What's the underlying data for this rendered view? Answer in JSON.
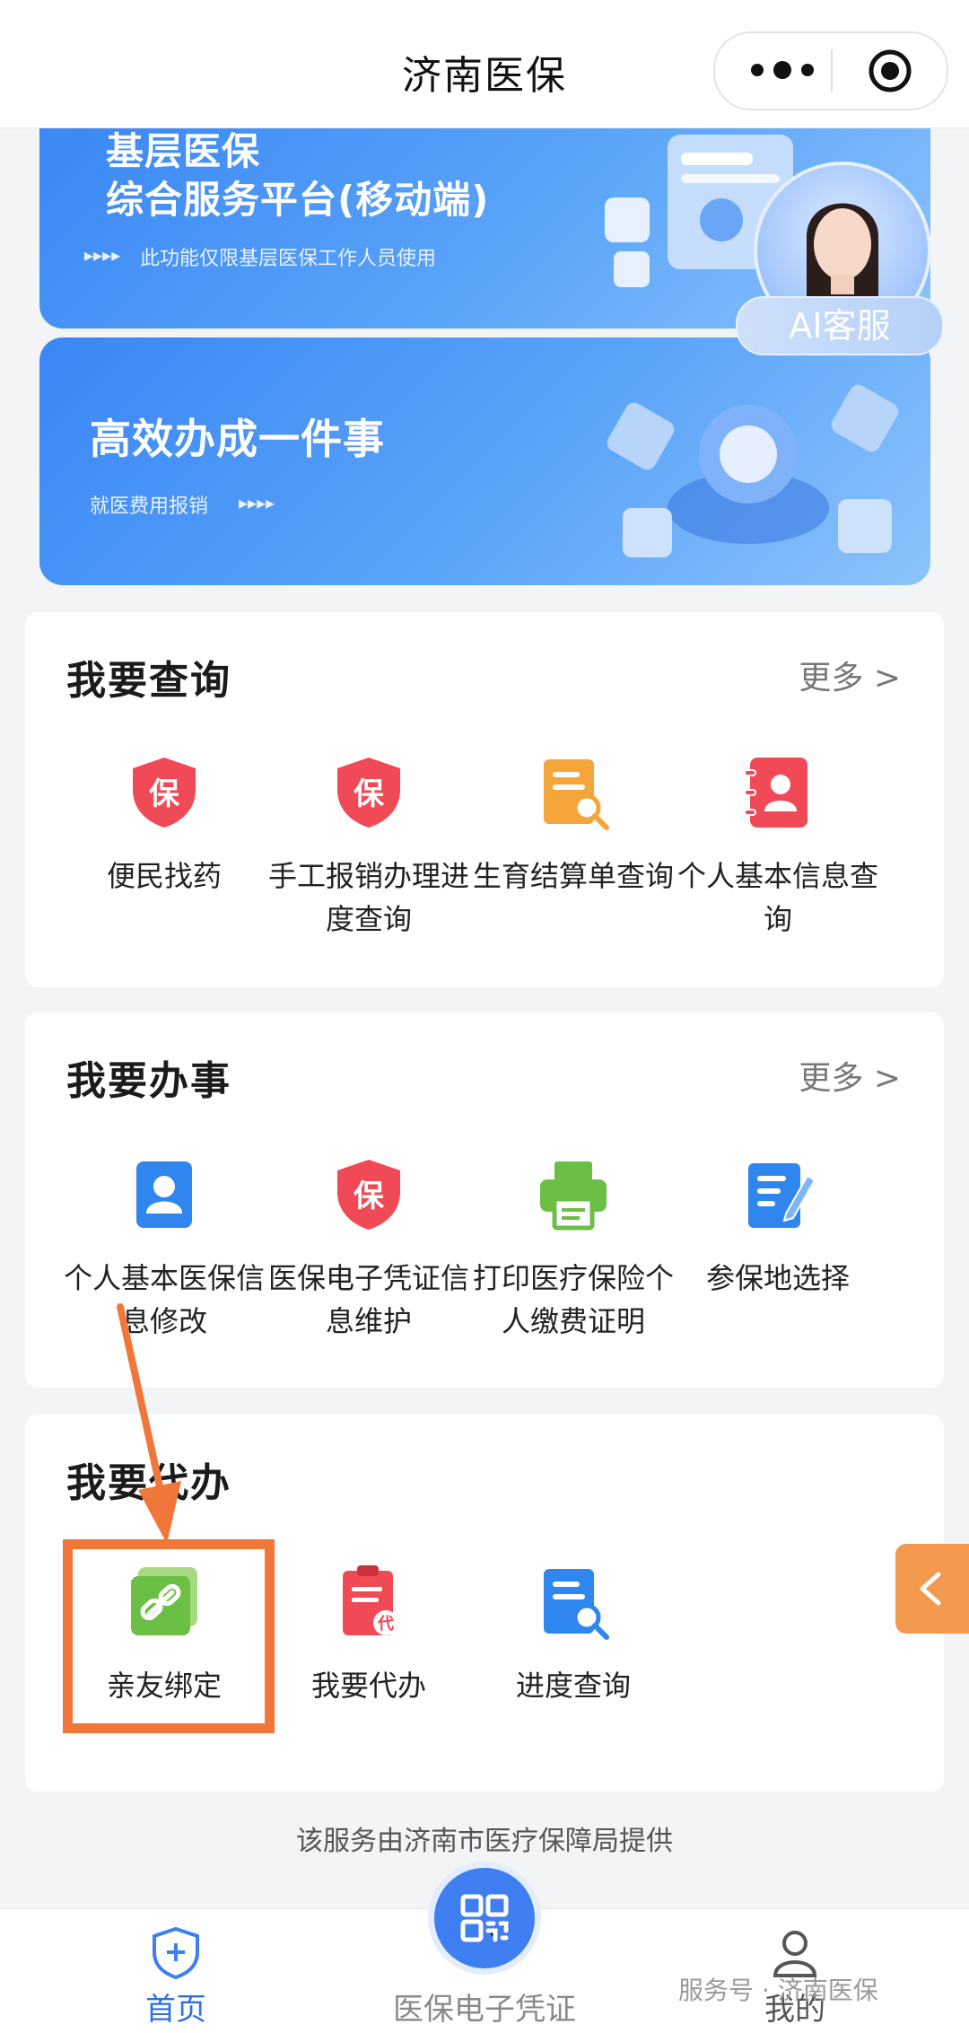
{
  "titlebar": {
    "title": "济南医保",
    "more_icon": "more-dots-icon",
    "close_icon": "target-circle-icon"
  },
  "banners": [
    {
      "title_line1": "基层医保",
      "title_line2": "综合服务平台(移动端)",
      "subtitle": "此功能仅限基层医保工作人员使用"
    },
    {
      "title": "高效办成一件事",
      "subtitle": "就医费用报销"
    }
  ],
  "ai_service": {
    "label": "AI客服"
  },
  "sections": {
    "query": {
      "title": "我要查询",
      "more": "更多 >",
      "items": [
        {
          "label": "便民找药",
          "icon": "shield-bao-icon",
          "color": "#ef4a55"
        },
        {
          "label": "手工报销办理进度查询",
          "icon": "shield-bao-icon",
          "color": "#ef4a55"
        },
        {
          "label": "生育结算单查询",
          "icon": "document-search-icon",
          "color": "#f6a53b"
        },
        {
          "label": "个人基本信息查询",
          "icon": "contact-book-icon",
          "color": "#ef4a55"
        }
      ]
    },
    "handle": {
      "title": "我要办事",
      "more": "更多 >",
      "items": [
        {
          "label": "个人基本医保信息修改",
          "icon": "person-card-icon",
          "color": "#2f86ee"
        },
        {
          "label": "医保电子凭证信息维护",
          "icon": "shield-bao-icon",
          "color": "#ef4a55"
        },
        {
          "label": "打印医疗保险个人缴费证明",
          "icon": "printer-icon",
          "color": "#6cbf45"
        },
        {
          "label": "参保地选择",
          "icon": "edit-document-icon",
          "color": "#2f86ee"
        }
      ]
    },
    "proxy": {
      "title": "我要代办",
      "items": [
        {
          "label": "亲友绑定",
          "icon": "link-icon",
          "color": "#6cbf45"
        },
        {
          "label": "我要代办",
          "icon": "proxy-document-icon",
          "color": "#ef4a55"
        },
        {
          "label": "进度查询",
          "icon": "document-search-icon",
          "color": "#2f86ee"
        }
      ]
    }
  },
  "provider_text": "该服务由济南市医疗保障局提供",
  "tabbar": {
    "home": "首页",
    "voucher": "医保电子凭证",
    "mine": "我的"
  },
  "watermark": "服务号 · 济南医保",
  "colors": {
    "primary": "#3f7ef0",
    "annotation": "#f0763a",
    "side_tab": "#f39a4e"
  }
}
